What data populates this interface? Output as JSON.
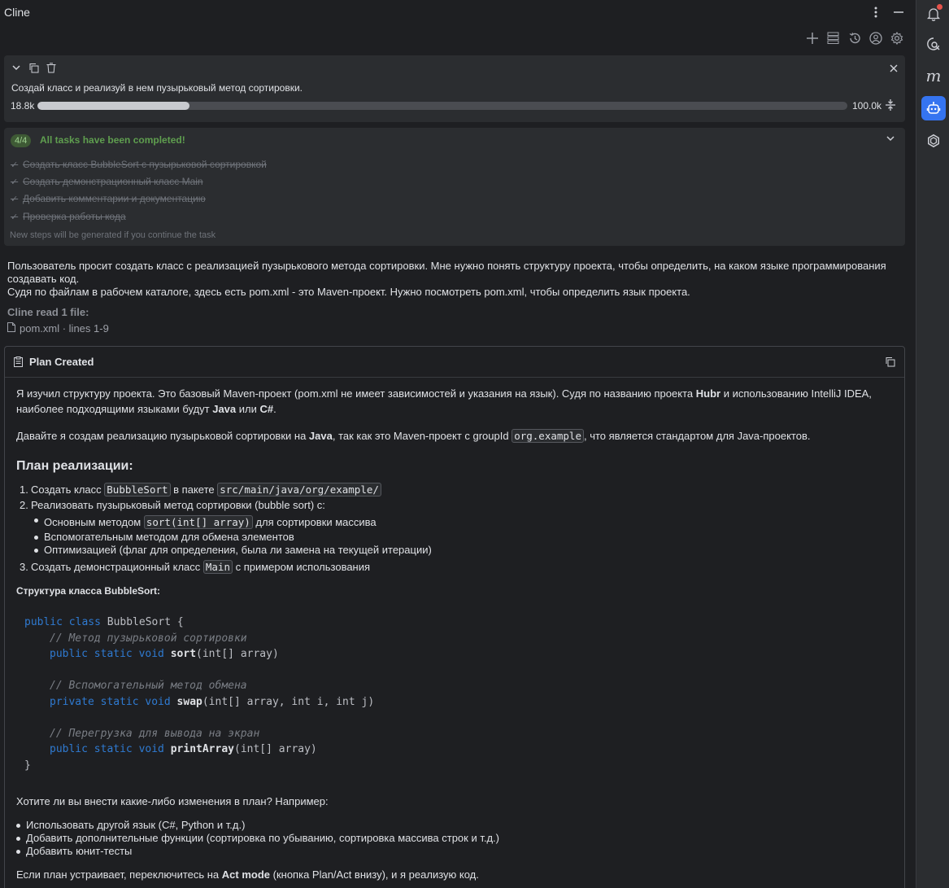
{
  "app": {
    "title": "Cline"
  },
  "task": {
    "text": "Создай класс и реализуй в нем пузырьковый метод сортировки.",
    "context_used": "18.8k",
    "context_max": "100.0k",
    "context_fraction": 0.188
  },
  "todo": {
    "badge": "4/4",
    "status": "All tasks have been completed!",
    "items": [
      "Создать класс BubbleSort с пузырьковой сортировкой",
      "Создать демонстрационный класс Main",
      "Добавить комментарии и документацию",
      "Проверка работы кода"
    ],
    "note": "New steps will be generated if you continue the task"
  },
  "thinking": {
    "line1": "Пользователь просит создать класс с реализацией пузырькового метода сортировки. Мне нужно понять структуру проекта, чтобы определить, на каком языке программирования создавать код.",
    "line2": "Судя по файлам в рабочем каталоге, здесь есть pom.xml - это Maven-проект. Нужно посмотреть pom.xml, чтобы определить язык проекта."
  },
  "read": {
    "label": "Cline read 1 file:",
    "file": "pom.xml · lines 1-9"
  },
  "plan": {
    "title": "Plan Created",
    "p1_a": "Я изучил структуру проекта. Это базовый Maven-проект (pom.xml не имеет зависимостей и указания на язык). Судя по названию проекта ",
    "p1_b": "Hubr",
    "p1_c": " и использованию IntelliJ IDEA, наиболее подходящими языками будут ",
    "p1_d": "Java",
    "p1_e": " или ",
    "p1_f": "C#",
    "p1_g": ".",
    "p2_a": "Давайте я создам реализацию пузырьковой сортировки на ",
    "p2_b": "Java",
    "p2_c": ", так как это Maven-проект с groupId ",
    "p2_code": "org.example",
    "p2_d": ", что является стандартом для Java-проектов.",
    "heading": "План реализации:",
    "s1_num": "1.",
    "s1_a": "Создать класс ",
    "s1_code1": "BubbleSort",
    "s1_b": " в пакете ",
    "s1_code2": "src/main/java/org/example/",
    "s2_num": "2.",
    "s2": "Реализовать пузырьковый метод сортировки (bubble sort) с:",
    "s2_sub1_a": "Основным методом ",
    "s2_sub1_code": "sort(int[] array)",
    "s2_sub1_b": " для сортировки массива",
    "s2_sub2": "Вспомогательным методом для обмена элементов",
    "s2_sub3": "Оптимизацией (флаг для определения, была ли замена на текущей итерации)",
    "s3_num": "3.",
    "s3_a": "Создать демонстрационный класс ",
    "s3_code": "Main",
    "s3_b": " с примером использования",
    "structure": "Структура класса BubbleSort:",
    "code": {
      "l1_kw": "public class ",
      "l1_name": "BubbleSort",
      "l1_rest": " {",
      "l2": "// Метод пузырьковой сортировки",
      "l3_kw": "public static void ",
      "l3_fn": "sort",
      "l3_rest": "(int[] array)",
      "l4": "// Вспомогательный метод обмена",
      "l5_kw": "private static void ",
      "l5_fn": "swap",
      "l5_rest": "(int[] array, int i, int j)",
      "l6": "// Перегрузка для вывода на экран",
      "l7_kw": "public static void ",
      "l7_fn": "printArray",
      "l7_rest": "(int[] array)",
      "l8": "}"
    },
    "question": "Хотите ли вы внести какие-либо изменения в план? Например:",
    "options": [
      "Использовать другой язык (C#, Python и т.д.)",
      "Добавить дополнительные функции (сортировка по убыванию, сортировка массива строк и т.д.)",
      "Добавить юнит-тесты"
    ],
    "final_a": "Если план устраивает, переключитесь на ",
    "final_b": "Act mode",
    "final_c": " (кнопка Plan/Act внизу), и я реализую код."
  },
  "colors": {
    "accent": "#3574f0",
    "success": "#5f9e4f",
    "keyword": "#2f7ad1"
  }
}
